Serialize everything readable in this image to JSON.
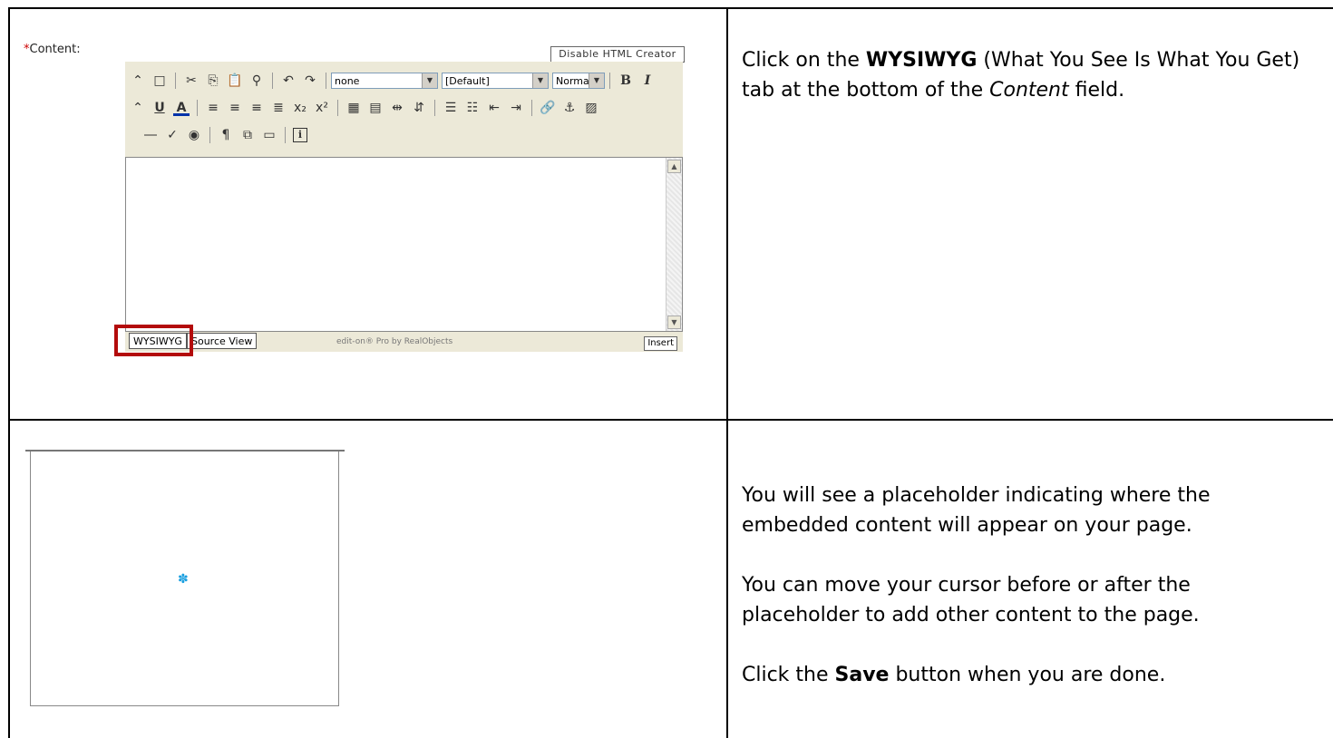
{
  "row1": {
    "editor": {
      "required_mark": "*",
      "content_label": "Content:",
      "disable_button": "Disable HTML Creator",
      "format_select": "none",
      "font_select": "[Default]",
      "size_select": "Normal",
      "tabs": [
        "WYSIWYG",
        "Source View"
      ],
      "credit": "edit-on® Pro by RealObjects",
      "insert_label": "Insert",
      "toolbar_icons": {
        "row1": [
          "collapse-icon",
          "new-doc-icon",
          "cut-icon",
          "copy-icon",
          "paste-icon",
          "find-icon",
          "undo-icon",
          "redo-icon",
          "bold-icon",
          "italic-icon"
        ],
        "row2": [
          "collapse-icon",
          "underline-icon",
          "font-color-icon",
          "align-left-icon",
          "align-center-icon",
          "align-right-icon",
          "justify-icon",
          "subscript-icon",
          "superscript-icon",
          "table-icon",
          "table-insert-icon",
          "split-icon",
          "merge-icon",
          "bullet-list-icon",
          "numbered-list-icon",
          "outdent-icon",
          "indent-icon",
          "link-icon",
          "anchor-icon",
          "image-icon"
        ],
        "row3": [
          "horizontal-rule-icon",
          "spellcheck-icon",
          "object-icon",
          "paragraph-mark-icon",
          "layer-icon",
          "frame-icon",
          "info-icon"
        ]
      },
      "highlight_color": "#b30b0b"
    },
    "instruction": {
      "t1": "Click on the ",
      "b1": "WYSIWYG",
      "t2": " (What You See Is What You Get) tab at the bottom of the ",
      "i1": "Content",
      "t3": " field."
    }
  },
  "row2": {
    "placeholder": {
      "icon": "plugin-placeholder-icon",
      "icon_color": "#1a9fe0"
    },
    "instructions": {
      "p1": "You will see a placeholder indicating where the embedded content will appear on your page.",
      "p2": "You can move your cursor before or after the placeholder to add other content to the page.",
      "p3_pre": "Click the ",
      "p3_bold": "Save",
      "p3_post": " button when you are done."
    }
  }
}
